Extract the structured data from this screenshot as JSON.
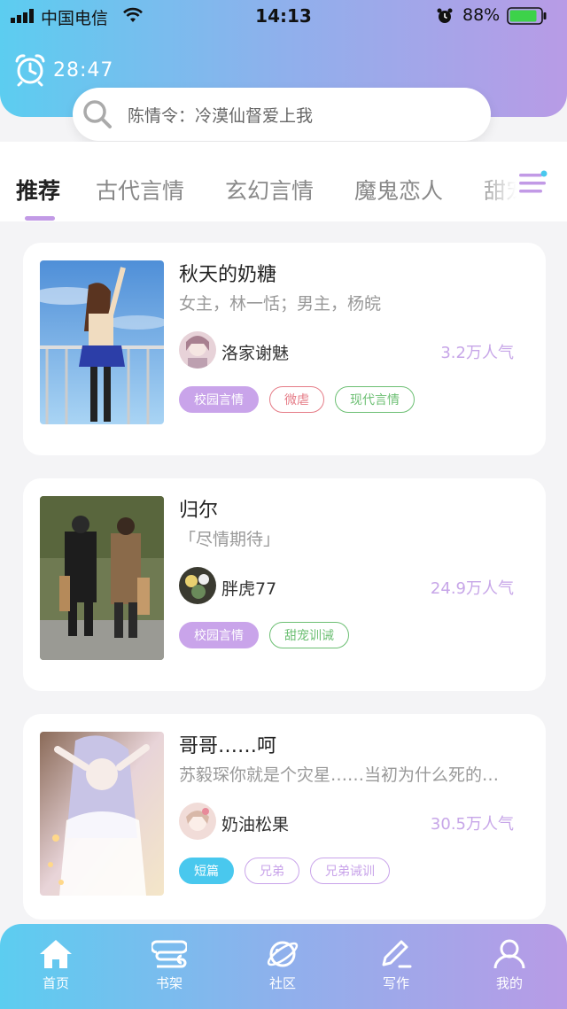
{
  "status_bar": {
    "carrier": "中国电信",
    "time": "14:13",
    "battery": "88%"
  },
  "timer": {
    "text": "28:47"
  },
  "search": {
    "placeholder": "陈情令：冷漠仙督爱上我"
  },
  "tabs": [
    {
      "label": "推荐",
      "active": true
    },
    {
      "label": "古代言情"
    },
    {
      "label": "玄幻言情"
    },
    {
      "label": "魔鬼恋人"
    },
    {
      "label": "甜宠"
    }
  ],
  "books": [
    {
      "title": "秋天的奶糖",
      "desc": "女主，林一恬；男主，杨皖",
      "author": "洛家谢魅",
      "popularity": "3.2万人气",
      "tags": [
        "校园言情",
        "微虐",
        "现代言情"
      ]
    },
    {
      "title": "归尔",
      "desc": "「尽情期待」",
      "author": "胖虎77",
      "popularity": "24.9万人气",
      "tags": [
        "校园言情",
        "甜宠训诫"
      ]
    },
    {
      "title": "哥哥……呵",
      "desc": "苏毅琛你就是个灾星……当初为什么死的…",
      "author": "奶油松果",
      "popularity": "30.5万人气",
      "tags": [
        "短篇",
        "兄弟",
        "兄弟诫训"
      ]
    }
  ],
  "bottom_nav": [
    {
      "label": "首页",
      "icon": "home-icon"
    },
    {
      "label": "书架",
      "icon": "bookshelf-icon"
    },
    {
      "label": "社区",
      "icon": "planet-icon"
    },
    {
      "label": "写作",
      "icon": "pen-icon"
    },
    {
      "label": "我的",
      "icon": "user-icon"
    }
  ],
  "colors": {
    "accent_cyan": "#5ccdf0",
    "accent_purple": "#b89be6",
    "popularity": "#c7a6e8"
  }
}
